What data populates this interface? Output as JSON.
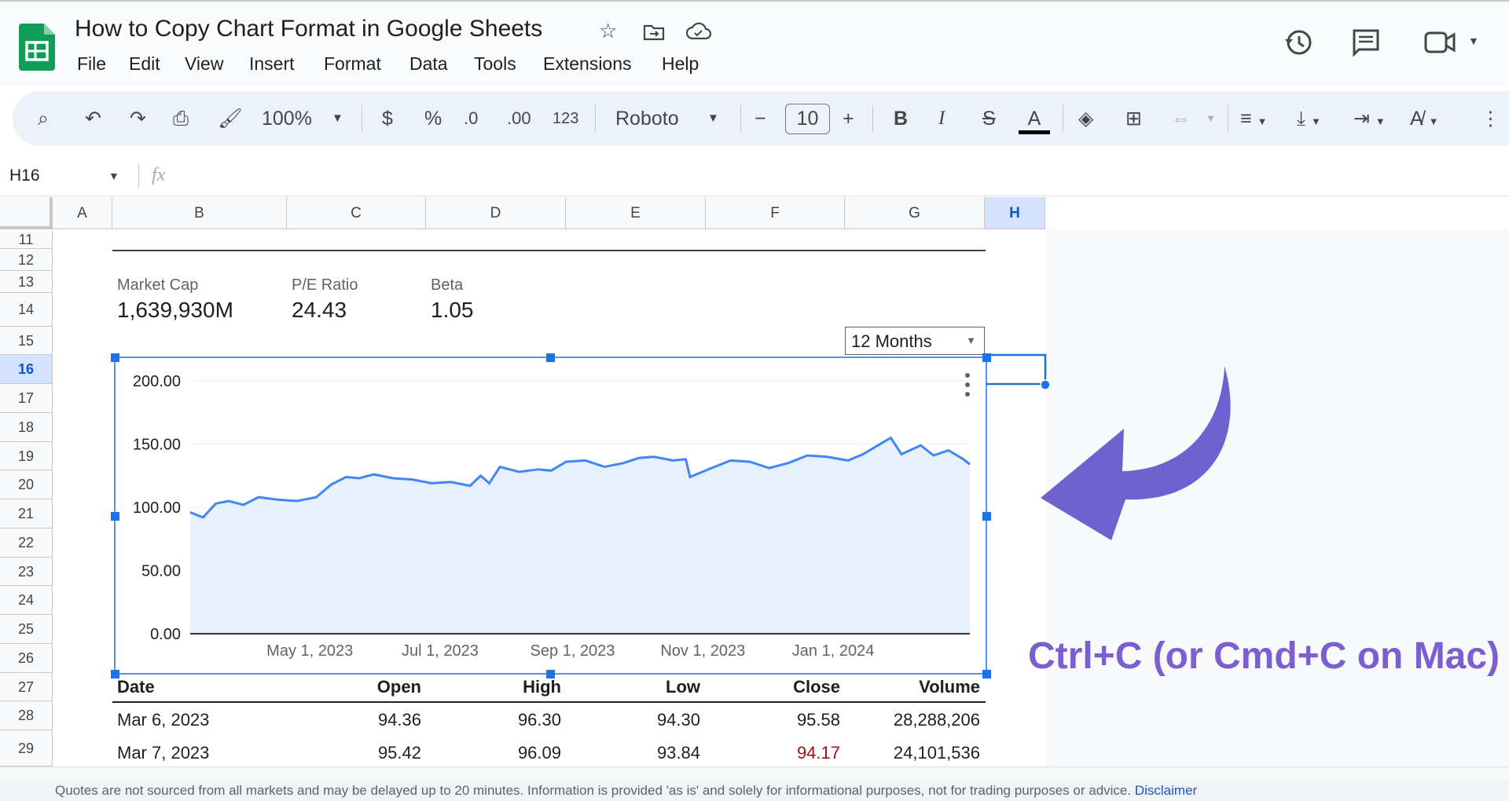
{
  "doc": {
    "title": "How to Copy Chart Format in Google Sheets",
    "menu": [
      "File",
      "Edit",
      "View",
      "Insert",
      "Format",
      "Data",
      "Tools",
      "Extensions",
      "Help"
    ],
    "title_icons": [
      "star-icon",
      "move-to-folder-icon",
      "cloud-saved-icon"
    ],
    "header_icons": [
      "version-history-icon",
      "comments-icon",
      "meet-video-icon"
    ]
  },
  "toolbar": {
    "zoom": "100%",
    "currency": "$",
    "percent": "%",
    "dec_minus": ".0",
    "dec_plus": ".00",
    "format_more": "123",
    "font": "Roboto",
    "font_size": "10",
    "bold": "B",
    "italic": "I",
    "strike": "S",
    "text_color": "A",
    "text_color_value": "#000000"
  },
  "formula_bar": {
    "name_box": "H16",
    "fx": "fx",
    "value": ""
  },
  "columns": [
    "A",
    "B",
    "C",
    "D",
    "E",
    "F",
    "G",
    "H"
  ],
  "selected_column": "H",
  "rows": [
    "11",
    "12",
    "13",
    "14",
    "15",
    "16",
    "17",
    "18",
    "19",
    "20",
    "21",
    "22",
    "23",
    "24",
    "25",
    "26",
    "27",
    "28",
    "29"
  ],
  "selected_row": "16",
  "stats": [
    {
      "label": "Market Cap",
      "value": "1,639,930M"
    },
    {
      "label": "P/E Ratio",
      "value": "24.43"
    },
    {
      "label": "Beta",
      "value": "1.05"
    }
  ],
  "range_dropdown": "12 Months",
  "chart_data": {
    "type": "area",
    "line_color": "#4285f4",
    "fill_color": "#e8f0fe",
    "ylim": [
      0,
      200
    ],
    "yticks": [
      "0.00",
      "50.00",
      "100.00",
      "150.00",
      "200.00"
    ],
    "xlim": [
      "2023-03-06",
      "2024-03-05"
    ],
    "xticks": [
      {
        "date": "2023-05-01",
        "label": "May 1, 2023"
      },
      {
        "date": "2023-07-01",
        "label": "Jul 1, 2023"
      },
      {
        "date": "2023-09-01",
        "label": "Sep 1, 2023"
      },
      {
        "date": "2023-11-01",
        "label": "Nov 1, 2023"
      },
      {
        "date": "2024-01-01",
        "label": "Jan 1, 2024"
      }
    ],
    "points": [
      [
        "2023-03-06",
        96
      ],
      [
        "2023-03-12",
        92
      ],
      [
        "2023-03-18",
        103
      ],
      [
        "2023-03-24",
        105
      ],
      [
        "2023-03-31",
        102
      ],
      [
        "2023-04-07",
        108
      ],
      [
        "2023-04-16",
        106
      ],
      [
        "2023-04-25",
        105
      ],
      [
        "2023-05-04",
        108
      ],
      [
        "2023-05-11",
        118
      ],
      [
        "2023-05-18",
        124
      ],
      [
        "2023-05-24",
        123
      ],
      [
        "2023-05-31",
        126
      ],
      [
        "2023-06-09",
        123
      ],
      [
        "2023-06-18",
        122
      ],
      [
        "2023-06-27",
        119
      ],
      [
        "2023-07-06",
        120
      ],
      [
        "2023-07-15",
        117
      ],
      [
        "2023-07-20",
        125
      ],
      [
        "2023-07-24",
        119
      ],
      [
        "2023-07-29",
        132
      ],
      [
        "2023-08-07",
        128
      ],
      [
        "2023-08-16",
        130
      ],
      [
        "2023-08-22",
        129
      ],
      [
        "2023-08-29",
        136
      ],
      [
        "2023-09-07",
        137
      ],
      [
        "2023-09-16",
        132
      ],
      [
        "2023-09-25",
        135
      ],
      [
        "2023-10-02",
        139
      ],
      [
        "2023-10-09",
        140
      ],
      [
        "2023-10-18",
        137
      ],
      [
        "2023-10-24",
        138
      ],
      [
        "2023-10-26",
        124
      ],
      [
        "2023-11-05",
        131
      ],
      [
        "2023-11-14",
        137
      ],
      [
        "2023-11-23",
        136
      ],
      [
        "2023-12-02",
        131
      ],
      [
        "2023-12-11",
        135
      ],
      [
        "2023-12-20",
        141
      ],
      [
        "2023-12-29",
        140
      ],
      [
        "2024-01-08",
        137
      ],
      [
        "2024-01-15",
        142
      ],
      [
        "2024-01-21",
        148
      ],
      [
        "2024-01-28",
        155
      ],
      [
        "2024-02-02",
        142
      ],
      [
        "2024-02-11",
        149
      ],
      [
        "2024-02-17",
        141
      ],
      [
        "2024-02-24",
        145
      ],
      [
        "2024-03-02",
        138
      ],
      [
        "2024-03-05",
        134
      ]
    ]
  },
  "table": {
    "headers": [
      "Date",
      "Open",
      "High",
      "Low",
      "Close",
      "Volume"
    ],
    "rows": [
      [
        "Mar 6, 2023",
        "94.36",
        "96.30",
        "94.30",
        "95.58",
        "28,288,206"
      ],
      [
        "Mar 7, 2023",
        "95.42",
        "96.09",
        "93.84",
        "94.17",
        "24,101,536"
      ]
    ],
    "down_color": "#a50e0e"
  },
  "annotation": {
    "text": "Ctrl+C (or Cmd+C on Mac)",
    "color": "#7b5fd1"
  },
  "footer": {
    "text": "Quotes are not sourced from all markets and may be delayed up to 20 minutes. Information is provided 'as is' and solely for informational purposes, not for trading purposes or advice.",
    "link": "Disclaimer"
  }
}
